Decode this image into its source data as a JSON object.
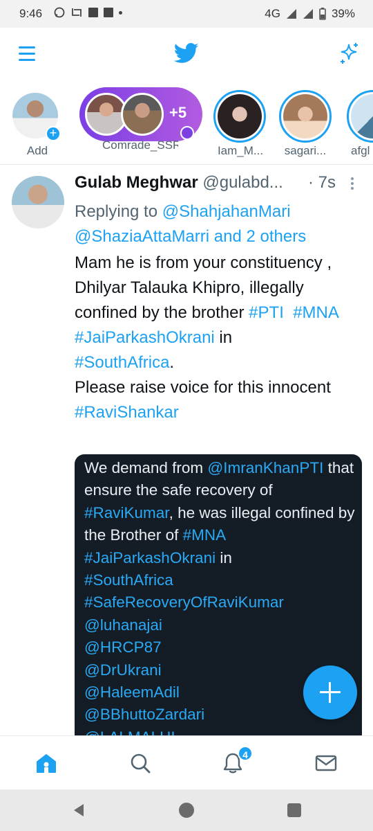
{
  "status_bar": {
    "time": "9:46",
    "network": "4G",
    "battery": "39%"
  },
  "app_bar": {
    "menu_icon": "hamburger-menu-icon",
    "logo_icon": "twitter-bird-icon",
    "action_icon": "sparkle-icon"
  },
  "fleets": {
    "items": [
      {
        "label": "Add"
      },
      {
        "label": "Comrade_SSR",
        "extra_count": "+5"
      },
      {
        "label": "Iam_M..."
      },
      {
        "label": "sagari..."
      },
      {
        "label": "afgl"
      }
    ]
  },
  "tweet": {
    "name": "Gulab Meghwar",
    "handle": "@gulabd...",
    "time": "· 7s",
    "replying_prefix": "Replying to ",
    "replying_user1": "@ShahjahanMari",
    "replying_user2": "@ShaziaAttaMarri",
    "replying_rest": " and 2 others",
    "body": {
      "l1": "Mam he is  from your constituency , Dhilyar Talauka Khipro, illegally confined by the brother ",
      "tag_pti": "#PTI",
      "tag_mna": "#MNA",
      "tag_jai": "#JaiParkashOkrani",
      "in": " in ",
      "tag_sa": "#SouthAfrica",
      "dot": ".",
      "l2": "Please raise voice for this innocent ",
      "tag_ravi": "#RaviShankar"
    },
    "image": {
      "t1": "We demand from ",
      "m_imran": "@ImranKhanPTI",
      "t2": " that ensure the safe recovery of ",
      "tag_ravikumar": "#RaviKumar",
      "t3": ", he was illegal confined by the Brother of ",
      "tag_mna": "#MNA",
      "tag_jai": "#JaiParkashOkrani",
      "t4": " in",
      "tag_sa": "#SouthAfrica",
      "tag_safe": "#SafeRecoveryOfRaviKumar",
      "m1": "@luhanajai",
      "m2": "@HRCP87",
      "m3": "@DrUkrani",
      "m4": "@HaleemAdil",
      "m5": "@BBhuttoZardari",
      "m6": "@LALMALHI"
    }
  },
  "fab": {
    "icon": "plus-icon"
  },
  "bottom_nav": {
    "home": "home-icon",
    "search": "search-icon",
    "notifications": "bell-icon",
    "notifications_badge": "4",
    "messages": "mail-icon"
  },
  "colors": {
    "accent": "#1da1f2",
    "text": "#0f1419",
    "muted": "#536471",
    "image_bg": "#141d26"
  }
}
